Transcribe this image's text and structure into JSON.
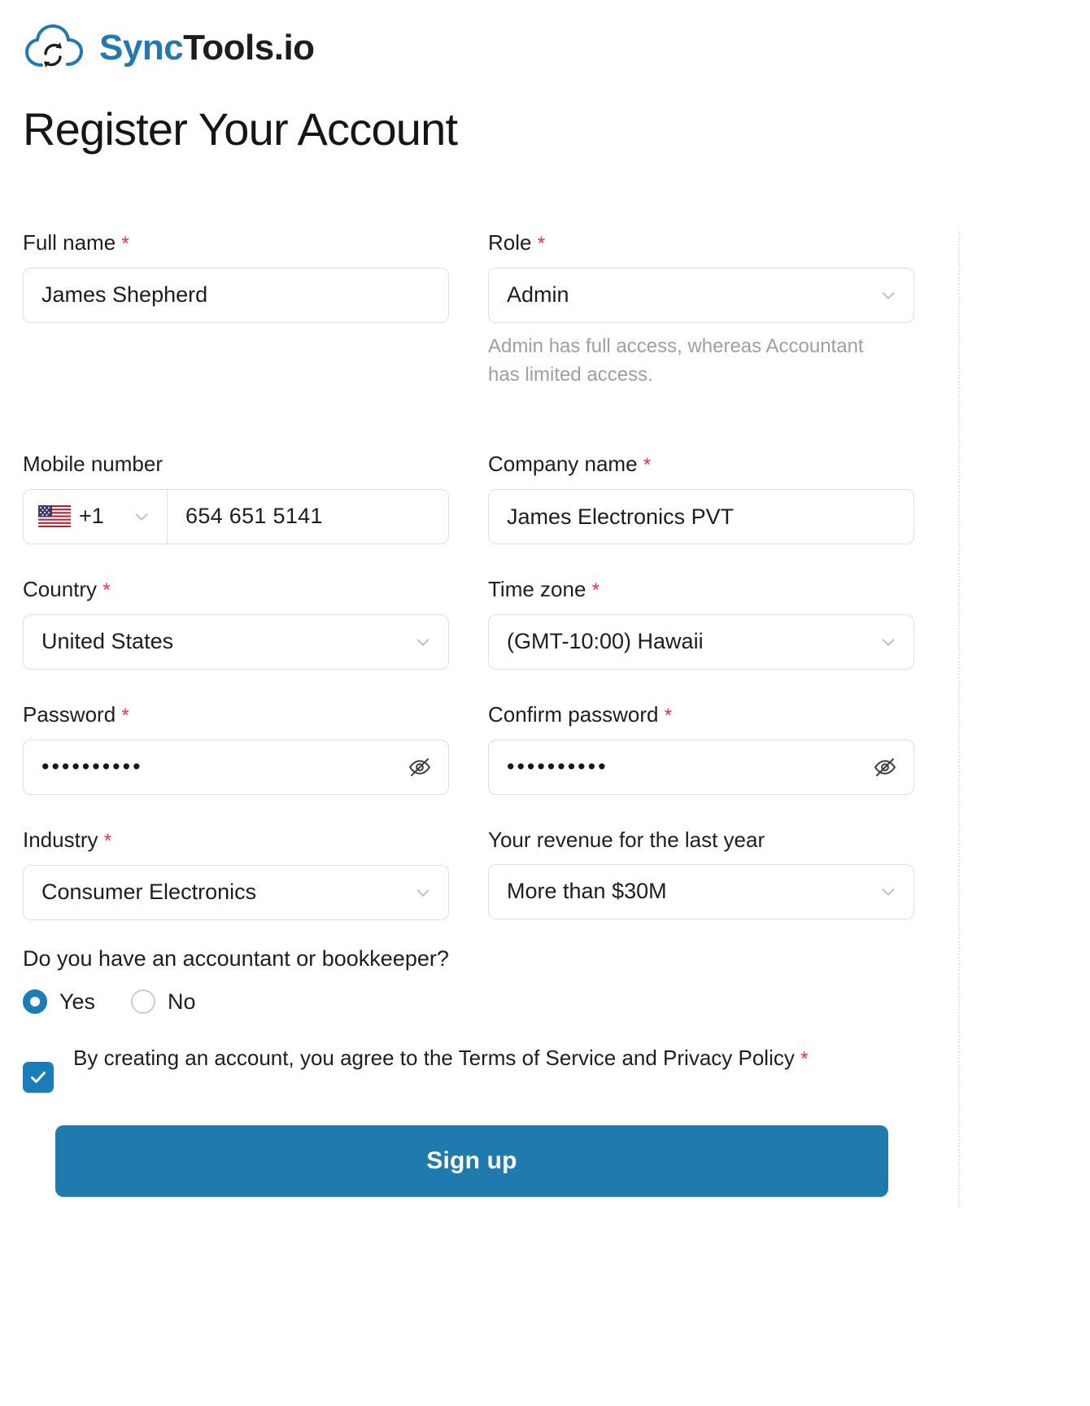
{
  "brand": {
    "name_part1": "Sync",
    "name_part2": "Tools.io",
    "logo_icon": "cloud-sync-icon",
    "accent_color": "#2478b0",
    "text_color": "#1d1d1f"
  },
  "page": {
    "title": "Register Your Account",
    "required_marker": "*"
  },
  "fields": {
    "full_name": {
      "label": "Full name",
      "required": true,
      "value": "James Shepherd"
    },
    "role": {
      "label": "Role",
      "required": true,
      "value": "Admin",
      "hint": "Admin has full access, whereas Accountant has limited access.",
      "chevron_icon": "chevron-down-icon"
    },
    "mobile_number": {
      "label": "Mobile number",
      "required": false,
      "country_code": "+1",
      "flag_icon": "us-flag-icon",
      "value": "654 651 5141",
      "chevron_icon": "chevron-down-icon"
    },
    "company_name": {
      "label": "Company name",
      "required": true,
      "value": "James Electronics PVT"
    },
    "country": {
      "label": "Country",
      "required": true,
      "value": "United States",
      "chevron_icon": "chevron-down-icon"
    },
    "time_zone": {
      "label": "Time zone",
      "required": true,
      "value": "(GMT-10:00) Hawaii",
      "chevron_icon": "chevron-down-icon"
    },
    "password": {
      "label": "Password",
      "required": true,
      "value": "••••••••••",
      "toggle_icon": "eye-off-icon"
    },
    "confirm_password": {
      "label": "Confirm password",
      "required": true,
      "value": "••••••••••",
      "toggle_icon": "eye-off-icon"
    },
    "industry": {
      "label": "Industry",
      "required": true,
      "value": "Consumer Electronics",
      "chevron_icon": "chevron-down-icon"
    },
    "revenue": {
      "label": "Your revenue for the last year",
      "required": false,
      "value": "More than $30M",
      "chevron_icon": "chevron-down-icon"
    }
  },
  "accountant_question": {
    "question": "Do you have an accountant or bookkeeper?",
    "options": [
      {
        "label": "Yes",
        "selected": true
      },
      {
        "label": "No",
        "selected": false
      }
    ]
  },
  "terms": {
    "checked": true,
    "check_icon": "checkmark-icon",
    "text": "By creating an account, you agree to the Terms of Service and Privacy Policy",
    "required_marker": "*"
  },
  "submit": {
    "label": "Sign up",
    "color": "#1f7bad"
  }
}
